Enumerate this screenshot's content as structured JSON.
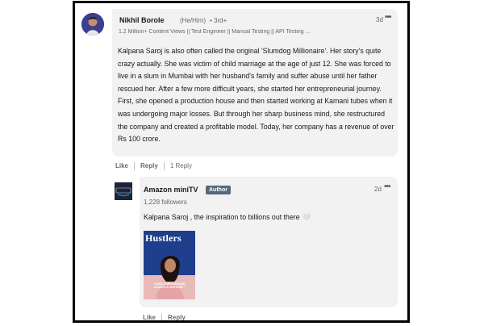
{
  "comment": {
    "author": "Nikhil Borole",
    "pronouns": "(He/Him)",
    "degree": "• 3rd+",
    "headline": "1.2 Million+ Content Views || Test Engineer || Manual Testing || API Testing ...",
    "time": "3d",
    "body": "Kalpana Saroj is also often called the original 'Slumdog Millionaire'. Her story's quite crazy actually. She was victim of child marriage at the age of just 12. She was forced to live in a slum in Mumbai with her husband's family and suffer abuse until her father rescued her. After a few more difficult years, she started her entrepreneurial journey. First, she opened a production house and then started working at Kamani tubes when it was undergoing major losses. But through her sharp business mind, she restructured the company and created a profitable model. Today, her company has a revenue of over Rs 100 crore.",
    "actions": {
      "like": "Like",
      "reply": "Reply",
      "reply_count": "1 Reply"
    }
  },
  "reply": {
    "author": "Amazon miniTV",
    "badge": "Author",
    "followers": "1,228 followers",
    "time": "2d",
    "text": "Kalpana Saroj , the inspiration to billions out there 🤍",
    "image": {
      "title": "Hustlers",
      "tagline": "\"ONCE A MILLIONAIRE, ALWAYS A HUSTLER.\"",
      "bg_color": "#1f3f8c"
    },
    "actions": {
      "like": "Like",
      "reply": "Reply"
    }
  },
  "icons": {
    "more": "more-options-icon",
    "logo": "amazon-minitv-logo"
  }
}
